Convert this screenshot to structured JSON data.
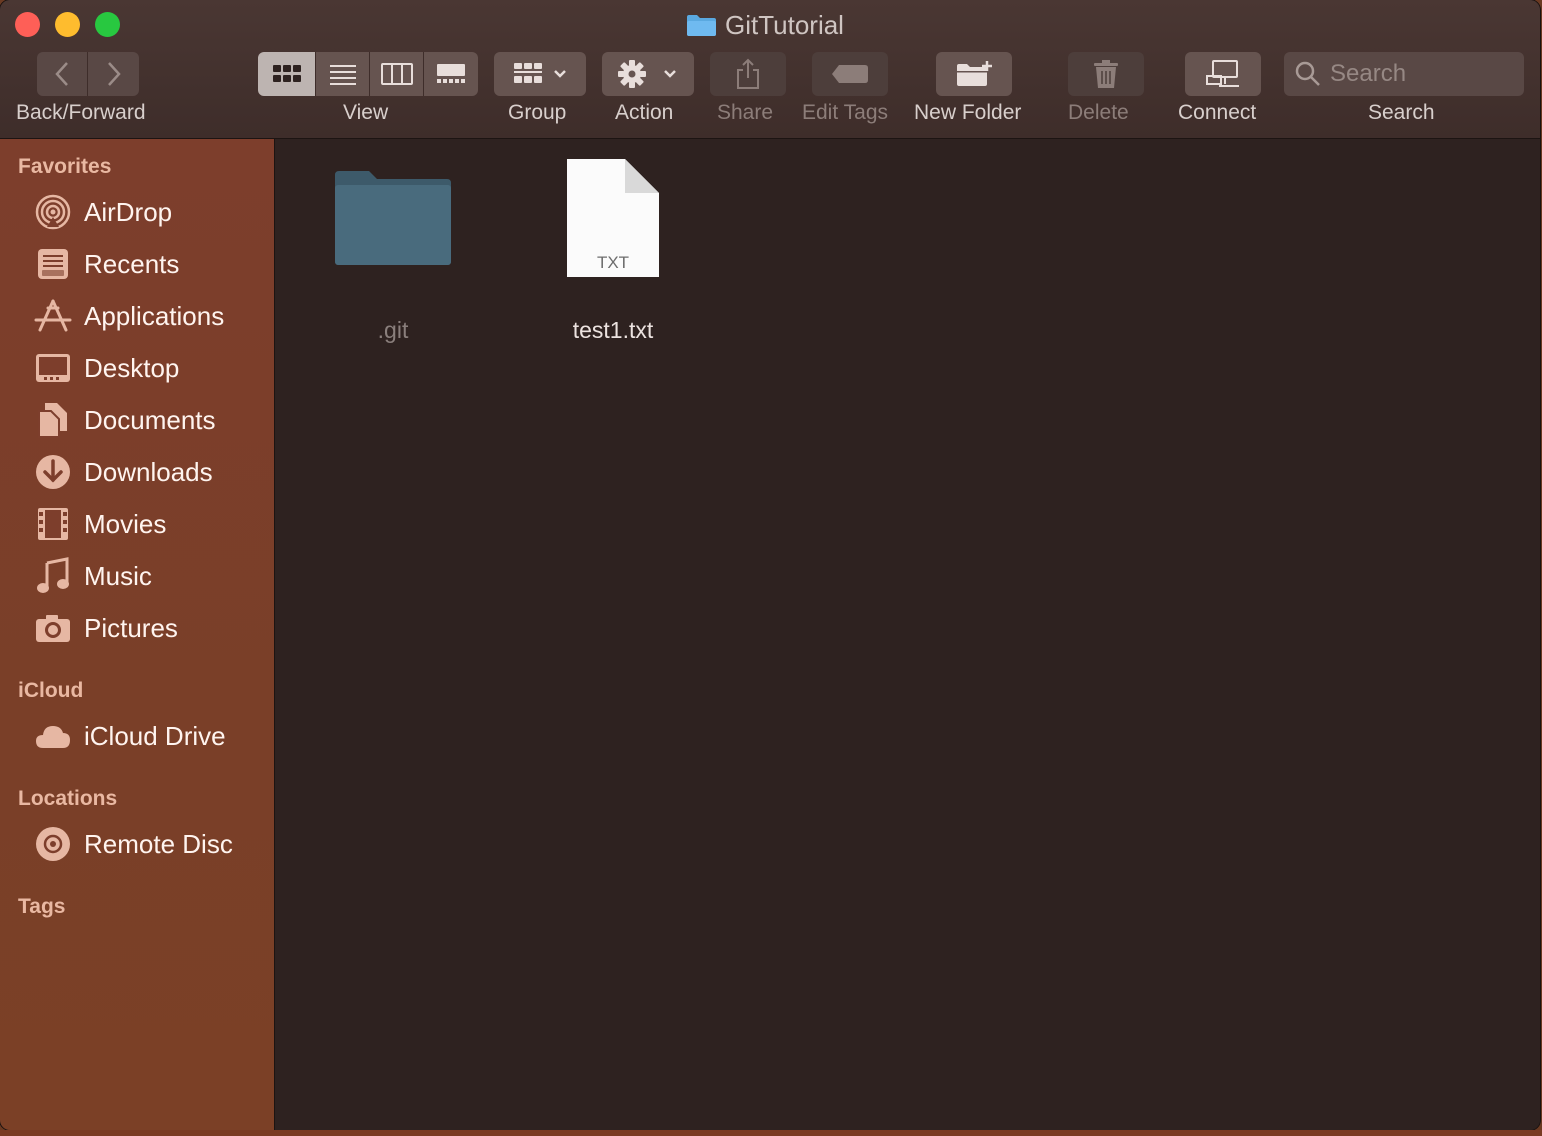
{
  "window": {
    "title": "GitTutorial"
  },
  "toolbar": {
    "back_forward_label": "Back/Forward",
    "view_label": "View",
    "group_label": "Group",
    "action_label": "Action",
    "share_label": "Share",
    "edit_tags_label": "Edit Tags",
    "new_folder_label": "New Folder",
    "delete_label": "Delete",
    "connect_label": "Connect",
    "search_label": "Search",
    "search_placeholder": "Search",
    "selected_view": "icon"
  },
  "sidebar": {
    "sections": {
      "favorites": "Favorites",
      "icloud": "iCloud",
      "locations": "Locations",
      "tags": "Tags"
    },
    "favorites": [
      {
        "label": "AirDrop",
        "icon": "airdrop-icon"
      },
      {
        "label": "Recents",
        "icon": "recents-icon"
      },
      {
        "label": "Applications",
        "icon": "applications-icon"
      },
      {
        "label": "Desktop",
        "icon": "desktop-icon"
      },
      {
        "label": "Documents",
        "icon": "documents-icon"
      },
      {
        "label": "Downloads",
        "icon": "downloads-icon"
      },
      {
        "label": "Movies",
        "icon": "movies-icon"
      },
      {
        "label": "Music",
        "icon": "music-icon"
      },
      {
        "label": "Pictures",
        "icon": "pictures-icon"
      }
    ],
    "icloud": [
      {
        "label": "iCloud Drive",
        "icon": "cloud-icon"
      }
    ],
    "locations": [
      {
        "label": "Remote Disc",
        "icon": "disc-icon"
      }
    ]
  },
  "files": [
    {
      "name": ".git",
      "type": "folder",
      "hidden": true
    },
    {
      "name": "test1.txt",
      "type": "txt",
      "badge": "TXT"
    }
  ],
  "colors": {
    "sidebar_bg": "#7d3e2c",
    "main_bg": "#2e2220",
    "accent_icon": "#e6b7a3"
  }
}
